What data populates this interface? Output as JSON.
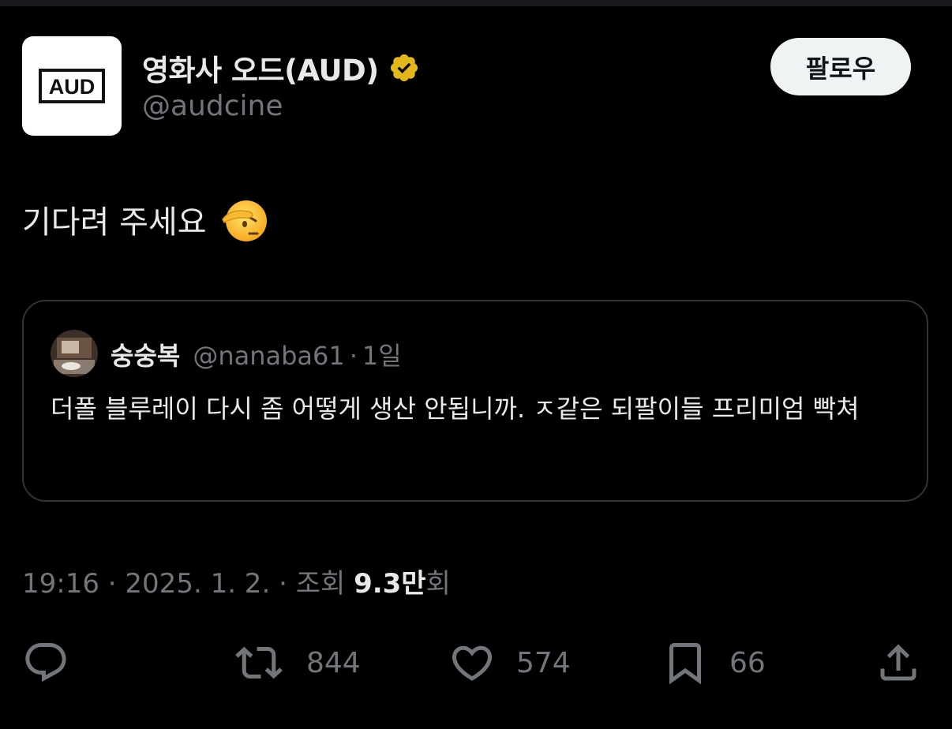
{
  "author": {
    "name": "영화사 오드(AUD)",
    "handle": "@audcine",
    "logo_text": "AUD",
    "verified_color": "#e2b719"
  },
  "follow_button": {
    "label": "팔로우"
  },
  "tweet": {
    "text": "기다려 주세요",
    "emoji_icon": "saluting-face-icon"
  },
  "quoted_tweet": {
    "name": "숭숭복",
    "handle": "@nanaba61",
    "separator": "·",
    "time": "1일",
    "text": "더폴 블루레이 다시 좀 어떻게 생산 안됩니까. ㅈ같은 되팔이들 프리미엄 빡쳐"
  },
  "meta": {
    "time": "19:16",
    "dot1": " · ",
    "date": "2025. 1. 2.",
    "dot2": " · ",
    "views_label": "조회 ",
    "views_count": "9.3만",
    "views_suffix": "회"
  },
  "actions": {
    "retweets": "844",
    "likes": "574",
    "bookmarks": "66"
  }
}
